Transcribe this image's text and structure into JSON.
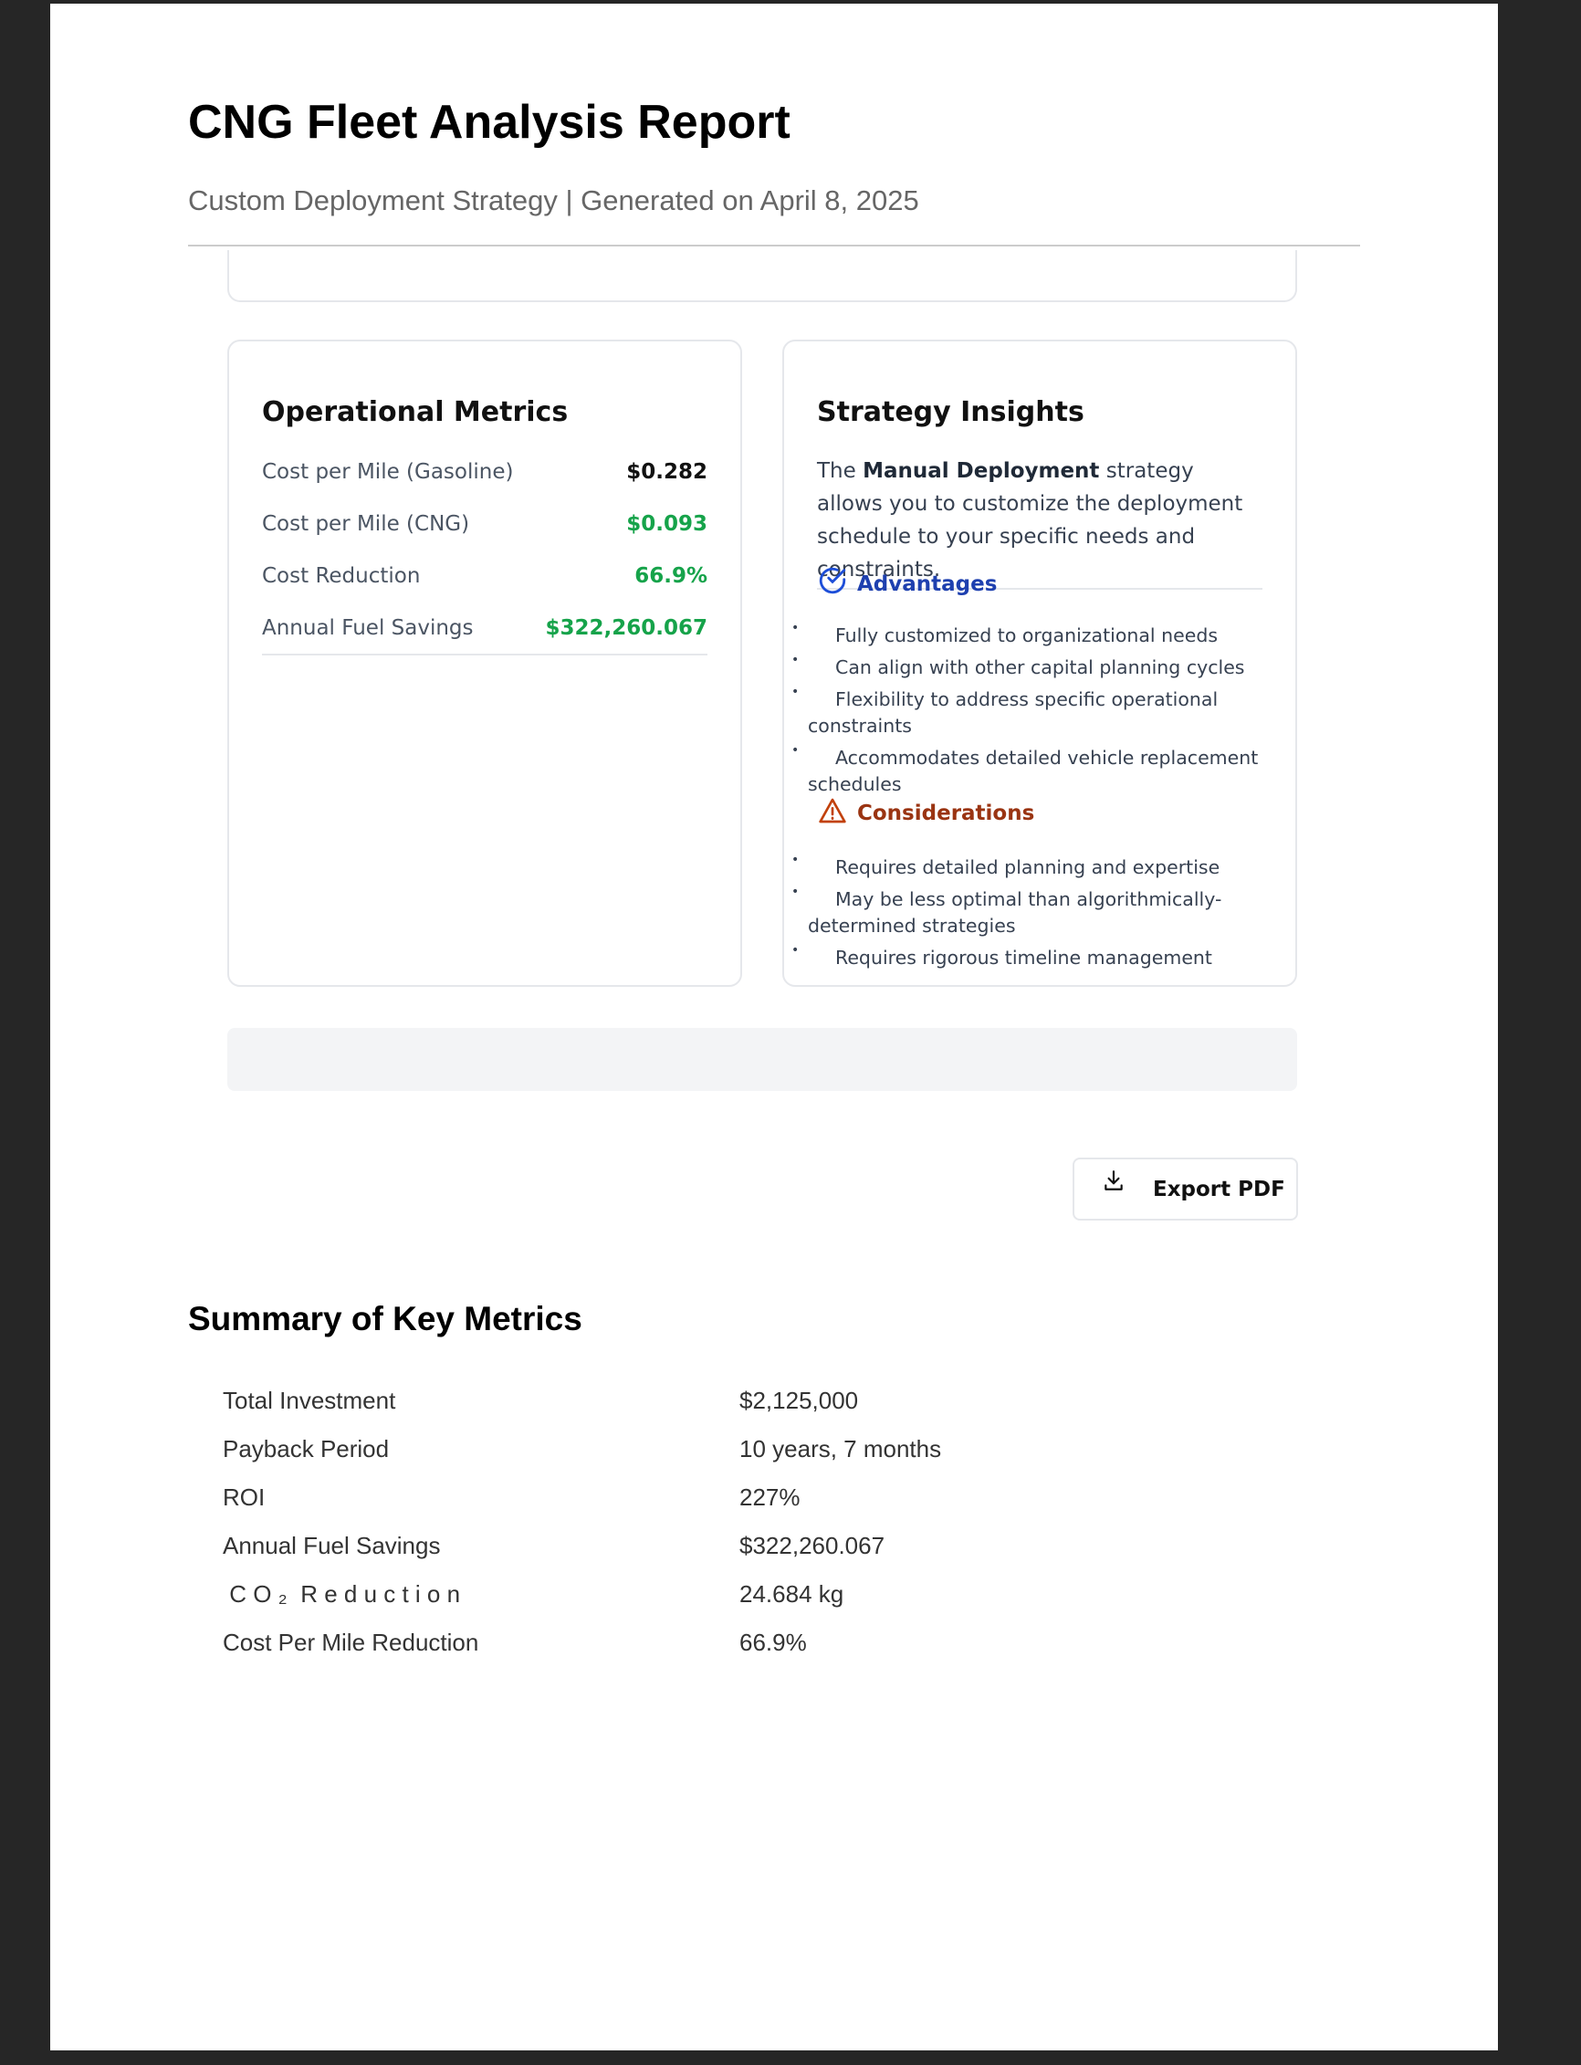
{
  "header": {
    "title": "CNG Fleet Analysis Report",
    "subtitle": "Custom Deployment Strategy | Generated on April 8, 2025"
  },
  "operational": {
    "title": "Operational Metrics",
    "rows": [
      {
        "label": "Cost per Mile (Gasoline)",
        "value": "$0.282"
      },
      {
        "label": "Cost per Mile (CNG)",
        "value": "$0.093"
      },
      {
        "label": "Cost Reduction",
        "value": "66.9%"
      },
      {
        "label": "Annual Fuel Savings",
        "value": "$322,260.067"
      }
    ]
  },
  "insights": {
    "title": "Strategy Insights",
    "intro_pre": "The ",
    "intro_bold": "Manual Deployment",
    "intro_post": " strategy allows you to customize the deployment schedule to your specific needs and constraints.",
    "advantages": {
      "title": "Advantages",
      "icon": "check-circle-icon",
      "color": "#1e40af",
      "items": [
        "Fully customized to organizational needs",
        "Can align with other capital planning cycles",
        "Flexibility to address specific operational constraints",
        "Accommodates detailed vehicle replacement schedules"
      ]
    },
    "considerations": {
      "title": "Considerations",
      "icon": "warning-triangle-icon",
      "color": "#9a3412",
      "items": [
        "Requires detailed planning and expertise",
        "May be less optimal than algorithmically-determined strategies",
        "Requires rigorous timeline management"
      ]
    }
  },
  "export": {
    "label": "Export PDF",
    "icon": "download-icon"
  },
  "summary": {
    "title": "Summary of Key Metrics",
    "rows": [
      {
        "label": "Total Investment",
        "value": "$2,125,000"
      },
      {
        "label": "Payback Period",
        "value": "10 years, 7 months"
      },
      {
        "label": "ROI",
        "value": "227%"
      },
      {
        "label": "Annual Fuel Savings",
        "value": "$322,260.067"
      },
      {
        "label": " C O ₂  R e d u c t i o n",
        "value": "24.684 kg"
      },
      {
        "label": "Cost Per Mile Reduction",
        "value": "66.9%"
      }
    ]
  },
  "colors": {
    "green": "#16a34a",
    "background": "#262626"
  }
}
